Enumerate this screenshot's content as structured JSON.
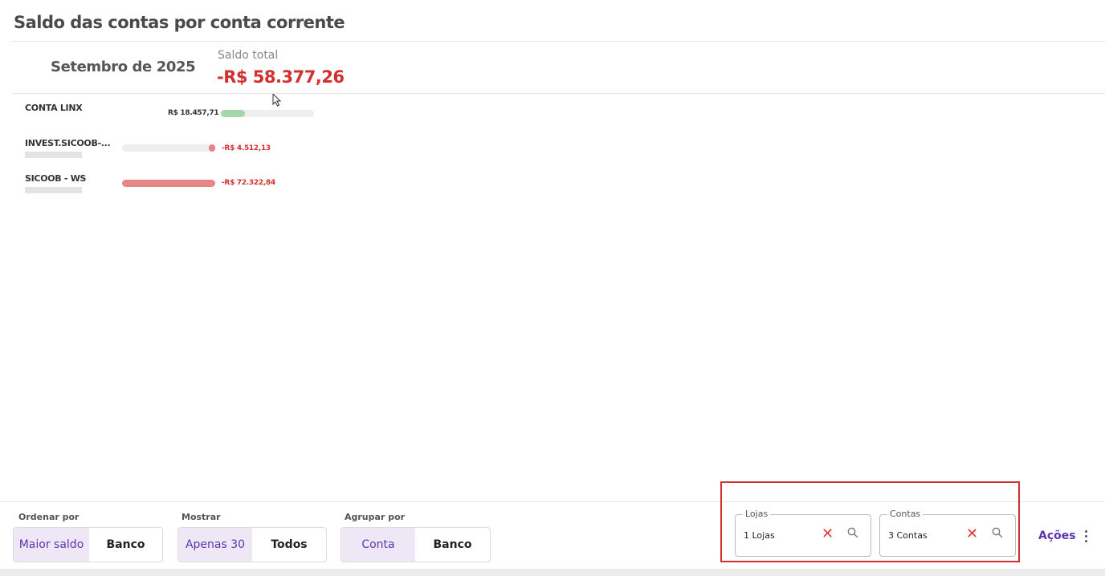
{
  "page": {
    "title": "Saldo das contas por conta corrente"
  },
  "summary": {
    "period": "Setembro de 2025",
    "total_label": "Saldo total",
    "total_value": "-R$ 58.377,26"
  },
  "accounts": [
    {
      "name": "CONTA LINX",
      "value": "R$ 18.457,71",
      "balance": 18457.71
    },
    {
      "name": "INVEST.SICOOB-...",
      "value": "-R$ 4.512,13",
      "balance": -4512.13
    },
    {
      "name": "SICOOB - WS",
      "value": "-R$ 72.322,84",
      "balance": -72322.84
    }
  ],
  "controls": {
    "ordenar": {
      "label": "Ordenar por",
      "options": [
        "Maior saldo",
        "Banco"
      ],
      "selected": "Maior saldo"
    },
    "mostrar": {
      "label": "Mostrar",
      "options": [
        "Apenas 30",
        "Todos"
      ],
      "selected": "Apenas 30"
    },
    "agrupar": {
      "label": "Agrupar por",
      "options": [
        "Conta",
        "Banco"
      ],
      "selected": "Conta"
    }
  },
  "filters": {
    "lojas": {
      "label": "Lojas",
      "value": "1 Lojas"
    },
    "contas": {
      "label": "Contas",
      "value": "3 Contas"
    }
  },
  "actions": {
    "label": "Ações"
  },
  "colors": {
    "negative": "#d32f2f",
    "positive_bar": "#a5d6a7",
    "negative_bar": "#e57373",
    "accent": "#5e35b1"
  }
}
